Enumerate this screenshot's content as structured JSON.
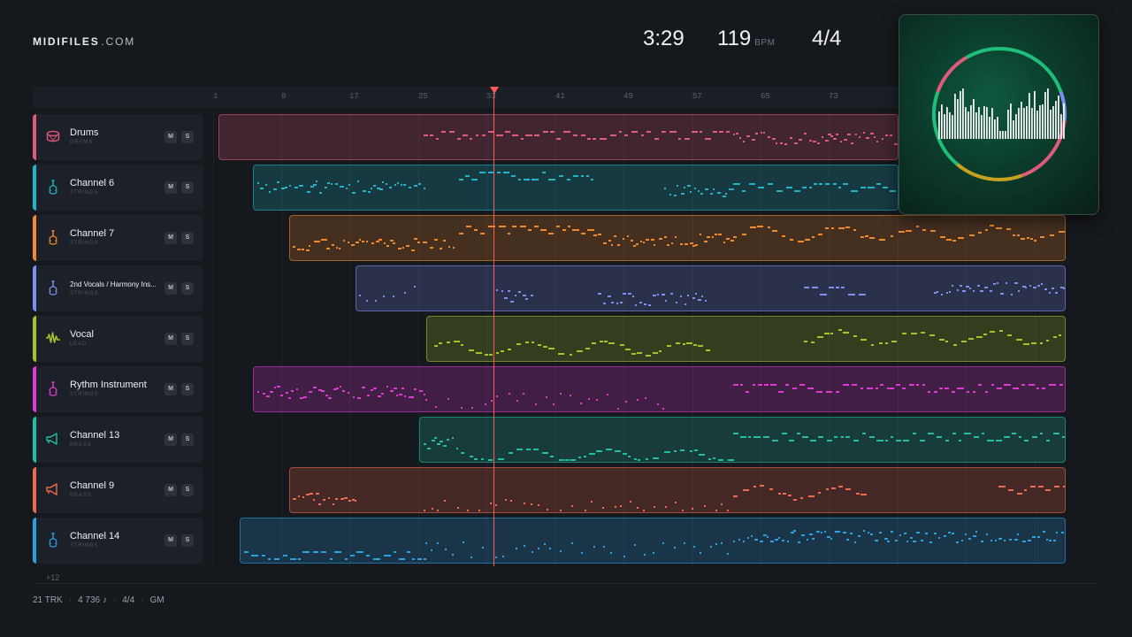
{
  "header": {
    "logo_bold": "MIDIFILES",
    "logo_rest": ".COM",
    "time": "3:29",
    "bpm_value": "119",
    "bpm_unit": "BPM",
    "time_signature": "4/4"
  },
  "ruler": {
    "ticks": [
      "1",
      "9",
      "17",
      "25",
      "33",
      "41",
      "49",
      "57",
      "65",
      "73"
    ]
  },
  "playhead": {
    "bar": "33"
  },
  "tracks": [
    {
      "name": "Drums",
      "type": "DRUMS",
      "color": "#e05a7a",
      "icon": "drum-icon",
      "mute_label": "M",
      "solo_label": "S"
    },
    {
      "name": "Channel 6",
      "type": "STRINGS",
      "color": "#22b3c8",
      "icon": "guitar-icon",
      "mute_label": "M",
      "solo_label": "S"
    },
    {
      "name": "Channel 7",
      "type": "STRINGS",
      "color": "#f08a2c",
      "icon": "guitar-icon",
      "mute_label": "M",
      "solo_label": "S"
    },
    {
      "name": "2nd Vocals / Harmony Ins...",
      "type": "STRINGS",
      "color": "#7f8ff0",
      "icon": "guitar-icon",
      "mute_label": "M",
      "solo_label": "S"
    },
    {
      "name": "Vocal",
      "type": "LEAD",
      "color": "#a8c32a",
      "icon": "waveform-icon",
      "mute_label": "M",
      "solo_label": "S"
    },
    {
      "name": "Rythm Instrument",
      "type": "STRINGS",
      "color": "#e03ad4",
      "icon": "guitar-icon",
      "mute_label": "M",
      "solo_label": "S"
    },
    {
      "name": "Channel 13",
      "type": "BRASS",
      "color": "#1fbfa0",
      "icon": "horn-icon",
      "mute_label": "M",
      "solo_label": "S"
    },
    {
      "name": "Channel 9",
      "type": "BRASS",
      "color": "#f06a4e",
      "icon": "horn-icon",
      "mute_label": "M",
      "solo_label": "S"
    },
    {
      "name": "Channel 14",
      "type": "STRINGS",
      "color": "#2aa0e0",
      "icon": "guitar-icon",
      "mute_label": "M",
      "solo_label": "S"
    }
  ],
  "more_tracks": "+12",
  "footer": {
    "tracks": "21 TRK",
    "notes": "4 736 ♪",
    "signature": "4/4",
    "standard": "GM"
  }
}
